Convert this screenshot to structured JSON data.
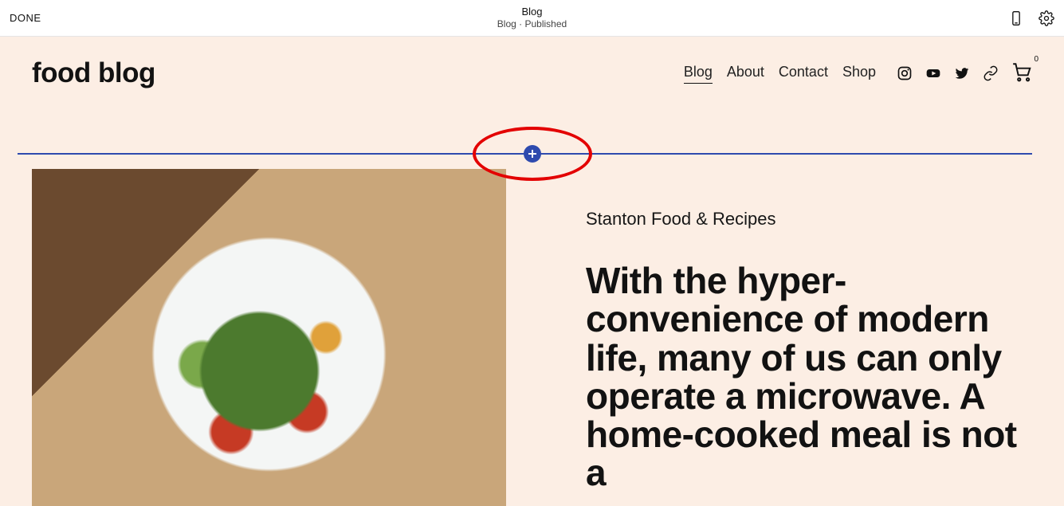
{
  "editor": {
    "done_label": "DONE",
    "page_title": "Blog",
    "page_status": "Blog · Published"
  },
  "site": {
    "title": "food blog",
    "nav": {
      "blog": "Blog",
      "about": "About",
      "contact": "Contact",
      "shop": "Shop"
    },
    "cart_count": "0"
  },
  "post": {
    "kicker": "Stanton Food & Recipes",
    "headline": "With the hyper-convenience of modern life, many of us can only operate a microwave. A home-cooked meal is not a"
  },
  "colors": {
    "canvas_bg": "#fceee4",
    "divider": "#2e4aae",
    "highlight": "#e30000"
  }
}
